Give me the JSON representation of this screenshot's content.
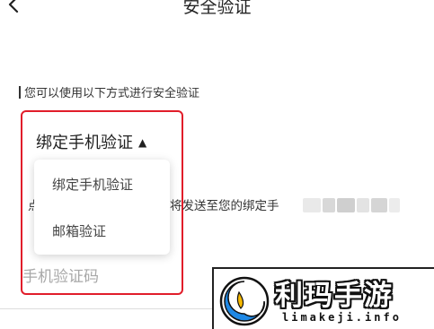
{
  "header": {
    "title": "安全验证",
    "back_icon": "chevron-left-icon"
  },
  "section_hint": "您可以使用以下方式进行安全验证",
  "method_selector": {
    "selected": "绑定手机验证",
    "arrow_icon": "caret-up-icon",
    "options": [
      "绑定手机验证",
      "邮箱验证"
    ]
  },
  "send_hint": {
    "prefix": "点",
    "text": "将发送至您的绑定手"
  },
  "code_input": {
    "placeholder": "手机验证码"
  },
  "colors": {
    "highlight": "#e11d2a",
    "logo_blue": "#1e88e5",
    "logo_yellow": "#f5b800"
  },
  "watermark": {
    "brand": "利玛手游",
    "url": "limakeji.info"
  }
}
